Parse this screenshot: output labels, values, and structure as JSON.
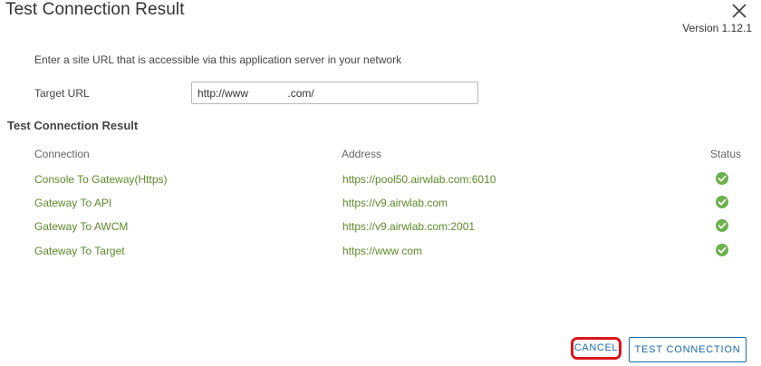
{
  "dialog": {
    "title": "Test Connection Result",
    "version": "Version 1.12.1",
    "close_icon": "close-icon"
  },
  "form": {
    "instruction": "Enter a site URL that is accessible via this application server in your network",
    "target_url_label": "Target URL",
    "target_url_value": "http://www             .com/"
  },
  "results": {
    "heading": "Test Connection Result",
    "columns": [
      "Connection",
      "Address",
      "Status"
    ],
    "rows": [
      {
        "connection": "Console To Gateway(Https)",
        "address": "https://pool50.airwlab.com:6010",
        "status": "success-check-icon"
      },
      {
        "connection": "Gateway To API",
        "address": "https://v9.airwlab.com",
        "status": "success-check-icon"
      },
      {
        "connection": "Gateway To AWCM",
        "address": "https://v9.airwlab.com:2001",
        "status": "success-check-icon"
      },
      {
        "connection": "Gateway To Target",
        "address": "https://www               com",
        "status": "success-check-icon"
      }
    ],
    "status_color": "#6bb24e",
    "link_color": "#5d8a2a"
  },
  "footer": {
    "cancel_label": "CANCEL",
    "test_connection_label": "TEST CONNECTION",
    "accent_color": "#1a6aa8",
    "highlight_color": "#d9161b"
  }
}
